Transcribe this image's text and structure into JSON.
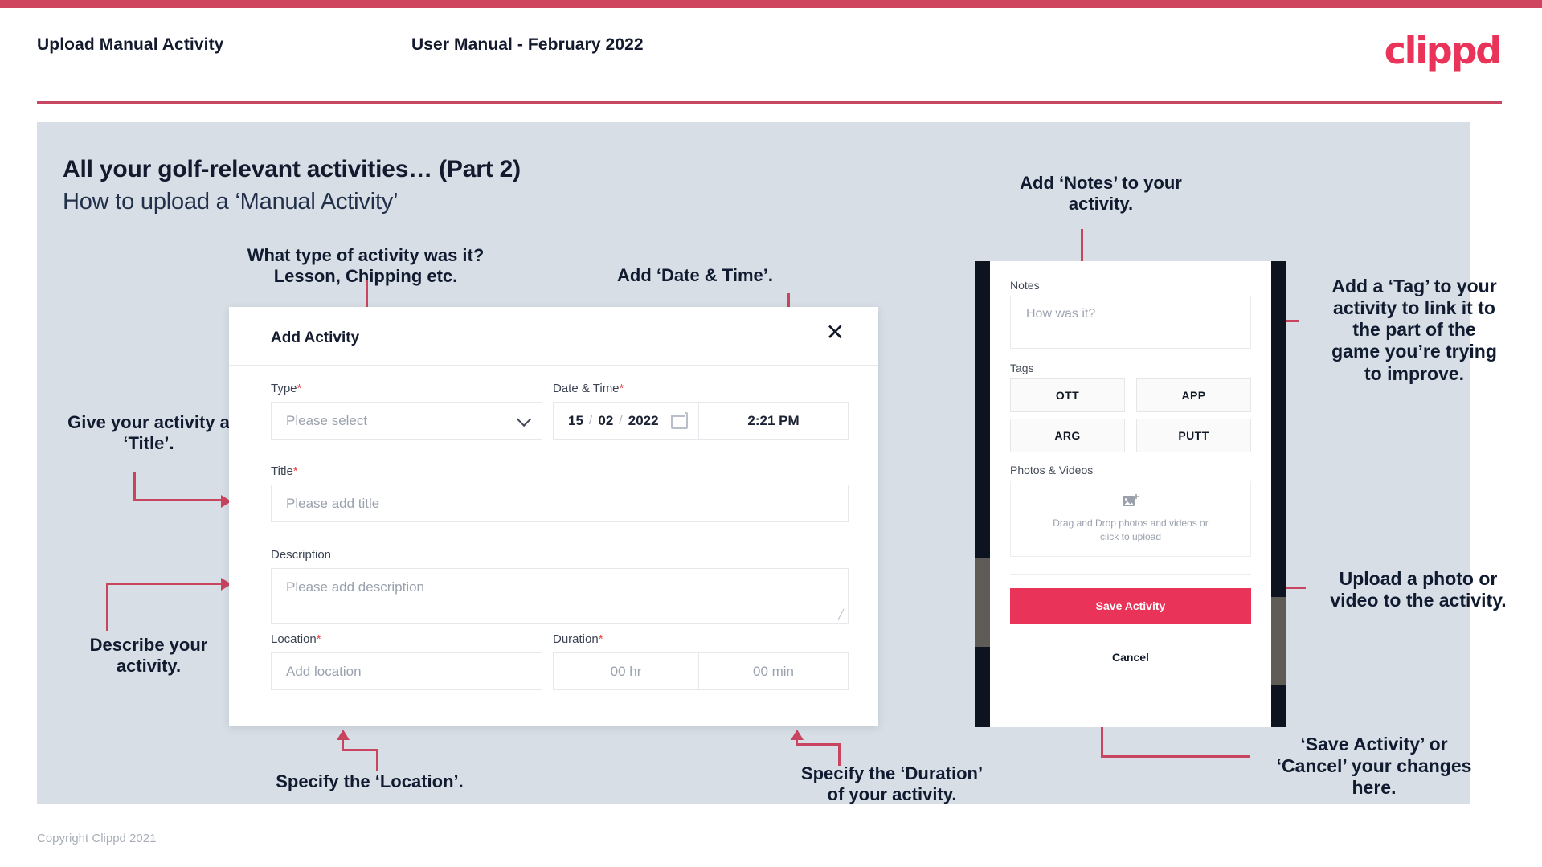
{
  "header": {
    "title": "Upload Manual Activity",
    "subtitle": "User Manual - February 2022",
    "logo": "clippd"
  },
  "panel": {
    "heading": "All your golf-relevant activities… (Part 2)",
    "subheading": "How to upload a ‘Manual Activity’"
  },
  "annotations": {
    "type": "What type of activity was it?\nLesson, Chipping etc.",
    "datetime": "Add ‘Date & Time’.",
    "title": "Give your activity a\n‘Title’.",
    "description": "Describe your\nactivity.",
    "location": "Specify the ‘Location’.",
    "duration": "Specify the ‘Duration’\nof your activity.",
    "notes": "Add ‘Notes’ to your\nactivity.",
    "tags": "Add a ‘Tag’ to your\nactivity to link it to\nthe part of the\ngame you’re trying\nto improve.",
    "photos": "Upload a photo or\nvideo to the activity.",
    "save": "‘Save Activity’ or\n‘Cancel’ your changes\nhere."
  },
  "dialog": {
    "title": "Add Activity",
    "close_icon": "close-icon",
    "fields": {
      "type": {
        "label": "Type",
        "required": "*",
        "placeholder": "Please select"
      },
      "datetime": {
        "label": "Date & Time",
        "required": "*",
        "day": "15",
        "sep1": "/",
        "month": "02",
        "sep2": "/",
        "year": "2022",
        "time": "2:21 PM"
      },
      "title": {
        "label": "Title",
        "required": "*",
        "placeholder": "Please add title"
      },
      "description": {
        "label": "Description",
        "required": "",
        "placeholder": "Please add description"
      },
      "location": {
        "label": "Location",
        "required": "*",
        "placeholder": "Add location"
      },
      "duration": {
        "label": "Duration",
        "required": "*",
        "hours": "00 hr",
        "minutes": "00 min"
      }
    }
  },
  "phone": {
    "notes": {
      "label": "Notes",
      "placeholder": "How was it?"
    },
    "tags": {
      "label": "Tags",
      "items": [
        "OTT",
        "APP",
        "ARG",
        "PUTT"
      ]
    },
    "photos": {
      "label": "Photos & Videos",
      "dropzone_line1": "Drag and Drop photos and videos or",
      "dropzone_line2": "click to upload",
      "icon": "add-image-icon"
    },
    "save_button": "Save Activity",
    "cancel_button": "Cancel"
  },
  "footer": {
    "copyright": "Copyright Clippd 2021"
  },
  "colors": {
    "accent": "#ea3359",
    "rule": "#c8465f",
    "panel_bg": "#d7dee6",
    "text_dark": "#131a2e"
  }
}
